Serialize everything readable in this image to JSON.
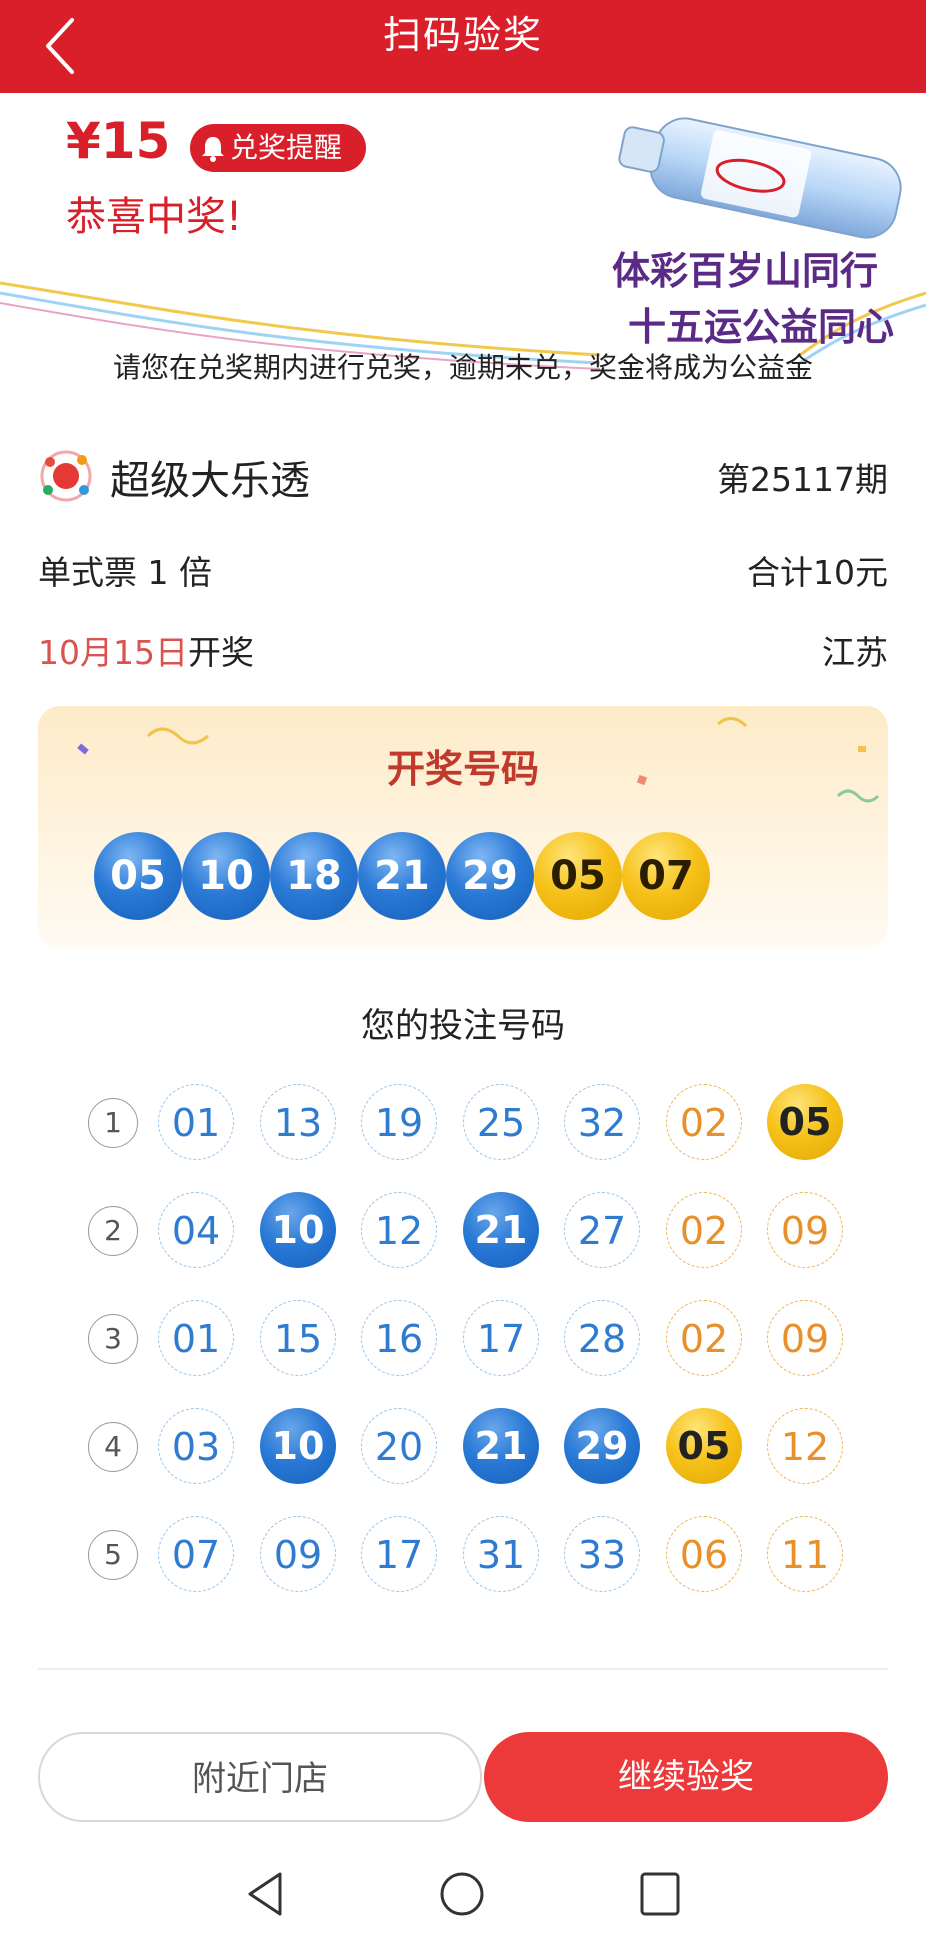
{
  "header": {
    "title": "扫码验奖"
  },
  "banner": {
    "prize": "¥15",
    "remind_label": "兑奖提醒",
    "congrats": "恭喜中奖!",
    "slogan_line1": "体彩百岁山同行",
    "slogan_line2": "十五运公益同心",
    "notice": "请您在兑奖期内进行兑奖，逾期未兑，奖金将成为公益金"
  },
  "ticket": {
    "lottery_name": "超级大乐透",
    "issue": "第25117期",
    "type": "单式票  1 倍",
    "total": "合计10元",
    "draw_date": "10月15日",
    "draw_suffix": "开奖",
    "region": "江苏"
  },
  "draw": {
    "title": "开奖号码",
    "front": [
      "05",
      "10",
      "18",
      "21",
      "29"
    ],
    "back": [
      "05",
      "07"
    ]
  },
  "bets": {
    "title": "您的投注号码",
    "rows": [
      {
        "index": "1",
        "front": [
          "01",
          "13",
          "19",
          "25",
          "32"
        ],
        "back": [
          "02",
          "05"
        ]
      },
      {
        "index": "2",
        "front": [
          "04",
          "10",
          "12",
          "21",
          "27"
        ],
        "back": [
          "02",
          "09"
        ]
      },
      {
        "index": "3",
        "front": [
          "01",
          "15",
          "16",
          "17",
          "28"
        ],
        "back": [
          "02",
          "09"
        ]
      },
      {
        "index": "4",
        "front": [
          "03",
          "10",
          "20",
          "21",
          "29"
        ],
        "back": [
          "05",
          "12"
        ]
      },
      {
        "index": "5",
        "front": [
          "07",
          "09",
          "17",
          "31",
          "33"
        ],
        "back": [
          "06",
          "11"
        ]
      }
    ]
  },
  "buttons": {
    "nearby": "附近门店",
    "continue": "继续验奖"
  },
  "colors": {
    "brand_red": "#d81f2a",
    "ball_blue": "#2a7ad6",
    "ball_gold": "#f6c21b",
    "slogan_purple": "#5a2a86"
  }
}
